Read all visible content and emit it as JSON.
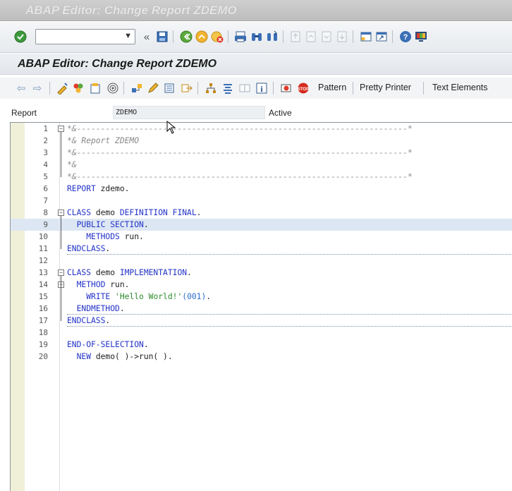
{
  "window": {
    "title": "ABAP Editor: Change Report ZDEMO"
  },
  "system_toolbar": {
    "command_field": {
      "value": "",
      "placeholder": ""
    }
  },
  "screen": {
    "title": "ABAP Editor: Change Report ZDEMO"
  },
  "app_toolbar": {
    "pattern_label": "Pattern",
    "pretty_printer_label": "Pretty Printer",
    "text_elements_label": "Text Elements"
  },
  "report": {
    "label": "Report",
    "name": "ZDEMO",
    "status": "Active"
  },
  "editor": {
    "highlighted_line": 9,
    "lines": [
      {
        "n": "1",
        "text": "*&---------------------------------------------------------------------*"
      },
      {
        "n": "2",
        "text": "*& Report ZDEMO"
      },
      {
        "n": "3",
        "text": "*&---------------------------------------------------------------------*"
      },
      {
        "n": "4",
        "text": "*&"
      },
      {
        "n": "5",
        "text": "*&---------------------------------------------------------------------*"
      },
      {
        "n": "6",
        "text": "REPORT zdemo."
      },
      {
        "n": "7",
        "text": ""
      },
      {
        "n": "8",
        "text": "CLASS demo DEFINITION FINAL."
      },
      {
        "n": "9",
        "text": "  PUBLIC SECTION."
      },
      {
        "n": "10",
        "text": "    METHODS run."
      },
      {
        "n": "11",
        "text": "ENDCLASS."
      },
      {
        "n": "12",
        "text": ""
      },
      {
        "n": "13",
        "text": "CLASS demo IMPLEMENTATION."
      },
      {
        "n": "14",
        "text": "  METHOD run."
      },
      {
        "n": "15",
        "text": "    WRITE 'Hello World!'(001)."
      },
      {
        "n": "16",
        "text": "  ENDMETHOD."
      },
      {
        "n": "17",
        "text": "ENDCLASS."
      },
      {
        "n": "18",
        "text": ""
      },
      {
        "n": "19",
        "text": "END-OF-SELECTION."
      },
      {
        "n": "20",
        "text": "  NEW demo( )->run( )."
      }
    ]
  },
  "colors": {
    "keyword": "#2232c8",
    "comment": "#888888",
    "string": "#2e8b2e",
    "highlight": "#dde7f3"
  }
}
